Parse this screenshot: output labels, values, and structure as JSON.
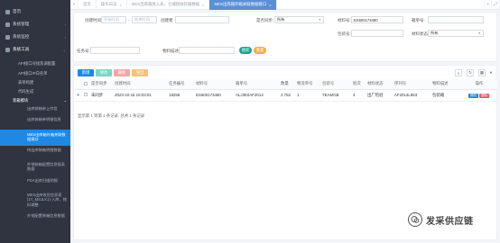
{
  "sidebar": {
    "items": [
      {
        "label": "首页"
      },
      {
        "label": "系统管理"
      },
      {
        "label": "系统监控"
      },
      {
        "label": "系统工具"
      }
    ],
    "sub_items": [
      {
        "label": "API接口对接及调配置"
      },
      {
        "label": "API接口IP白名单"
      },
      {
        "label": "表单构建"
      },
      {
        "label": "代码生成"
      }
    ],
    "group": {
      "label": "装箱模块"
    },
    "group_items": [
      {
        "label": "出库装箱单上传信"
      },
      {
        "label": "出库装箱单明细信息"
      },
      {
        "label": "MES出库箱外箱关联数据接口",
        "active": true
      },
      {
        "label": "待出库装箱明细数据"
      },
      {
        "label": "外销装箱配置信息报表数据"
      },
      {
        "label": "PDA出库扫描明细"
      },
      {
        "label": "MES出库收货信息表(1T_MSJLK1)-入库、物料调整"
      },
      {
        "label": "外销配置装箱信息数据"
      }
    ]
  },
  "tabs": {
    "items": [
      {
        "label": "首页"
      },
      {
        "label": "操作日志"
      },
      {
        "label": "MES出库箱接入表、仓储接收装箱数据"
      },
      {
        "label": "MES出库箱外箱关联数据接口",
        "active": true
      }
    ]
  },
  "filters": {
    "create_time_label": "创建时间:",
    "create_time_start_ph": "开始时间",
    "create_time_sep": "-",
    "create_time_end_ph": "结束时间",
    "creator_label": "创建者:",
    "sync_status_label": "是否同步:",
    "sync_status_value": "所有",
    "material_no_label": "材料号:",
    "material_no_value": "ES600173480",
    "box_no_label": "箱单号:",
    "pack_no_label": "包装号:",
    "lot_label": "材料状态:",
    "lot_value": "所有",
    "task_label": "任务号:",
    "material_desc_label": "物料描述:",
    "search_label": "搜索",
    "reset_label": "重置"
  },
  "toolbar": {
    "add_label": "新增",
    "edit_label": "修改",
    "delete_label": "删除",
    "export_label": "导出",
    "search_icon": "search-icon",
    "refresh_icon": "refresh-icon",
    "columns_icon": "columns-icon"
  },
  "table": {
    "headers": [
      "",
      "",
      "是否同步",
      "创建时间",
      "任务编号",
      "材料号",
      "箱单号",
      "数量",
      "物流单号",
      "包装号",
      "批次",
      "材料状态",
      "序列号",
      "物料描述",
      "操作"
    ],
    "rows": [
      {
        "sync": "未同步",
        "created": "2023-10-15 15:03:01",
        "task": "18259",
        "material": "ES600173480",
        "box": "ALJ3K0AF2014",
        "qty": "2 752",
        "logistics": "1",
        "pack": "TEAMGB",
        "batch": "4",
        "status": "出厂检验",
        "serial": "AF2014L853",
        "desc": "包装箱",
        "edit": "修改",
        "delete": "删除"
      }
    ]
  },
  "pager": {
    "text": "显示第 1 到第 1 条记录, 总共 1 条记录"
  },
  "watermark": {
    "text": "发采供应链"
  }
}
